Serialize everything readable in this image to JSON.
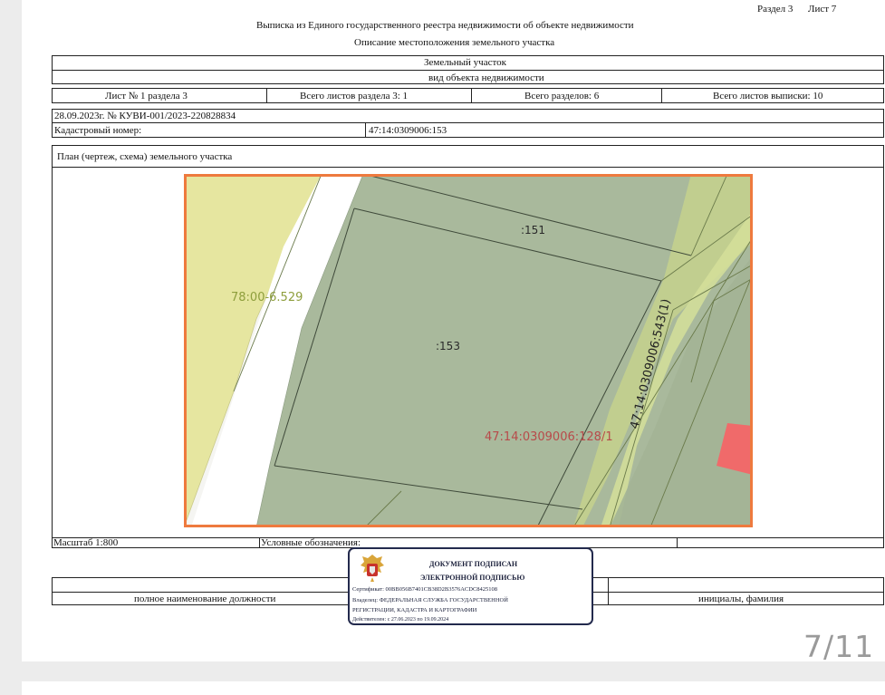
{
  "header": {
    "section_label": "Раздел 3",
    "sheet_label": "Лист 7",
    "title_line1": "Выписка из Единого государственного реестра недвижимости об объекте недвижимости",
    "title_line2": "Описание местоположения земельного участка"
  },
  "object": {
    "type": "Земельный участок",
    "subtitle": "вид объекта недвижимости"
  },
  "sheet_info": {
    "sheet_no": "Лист № 1 раздела 3",
    "total_sheets_section": "Всего листов раздела 3: 1",
    "total_sections": "Всего разделов: 6",
    "total_sheets_extract": "Всего листов выписки: 10"
  },
  "record": {
    "date_number": "28.09.2023г. № КУВИ-001/2023-220828834",
    "cadastral_label": "Кадастровый номер:",
    "cadastral_value": "47:14:0309006:153"
  },
  "plan": {
    "title": "План (чертеж, схема) земельного участка",
    "labels": {
      "parcel_left": "78:00-6.529",
      "parcel_151": ":151",
      "parcel_153": ":153",
      "parcel_128": "47:14:0309006:128/1",
      "parcel_543": "47:14:0309006:543(1)"
    },
    "colors": {
      "border": "#ee7a3e",
      "main_fill": "#a9b99c",
      "yellow_fill": "#e6e6a0",
      "green_fill": "#c9d68b",
      "red_fill": "#f06a6a",
      "label_red": "#b84a4a",
      "label_olive": "#8e9e3c"
    }
  },
  "footer": {
    "scale": "Масштаб 1:800",
    "legend": "Условные обозначения:",
    "position_label": "полное наименование должности",
    "initials_label": "инициалы, фамилия"
  },
  "stamp": {
    "line1": "ДОКУМЕНТ ПОДПИСАН",
    "line2": "ЭЛЕКТРОННОЙ ПОДПИСЬЮ",
    "certificate": "Сертификат: 00BB056B7401CB38D2B3576ACDC8425108",
    "owner_line1": "Владелец: ФЕДЕРАЛЬНАЯ СЛУЖБА ГОСУДАРСТВЕННОЙ",
    "owner_line2": "РЕГИСТРАЦИИ, КАДАСТРА И КАРТОГРАФИИ",
    "valid": "Действителен: с 27.06.2023 по 19.09.2024",
    "emblem_icon": "russian-coat-of-arms-icon"
  },
  "viewer": {
    "page_indicator": "7/11"
  }
}
